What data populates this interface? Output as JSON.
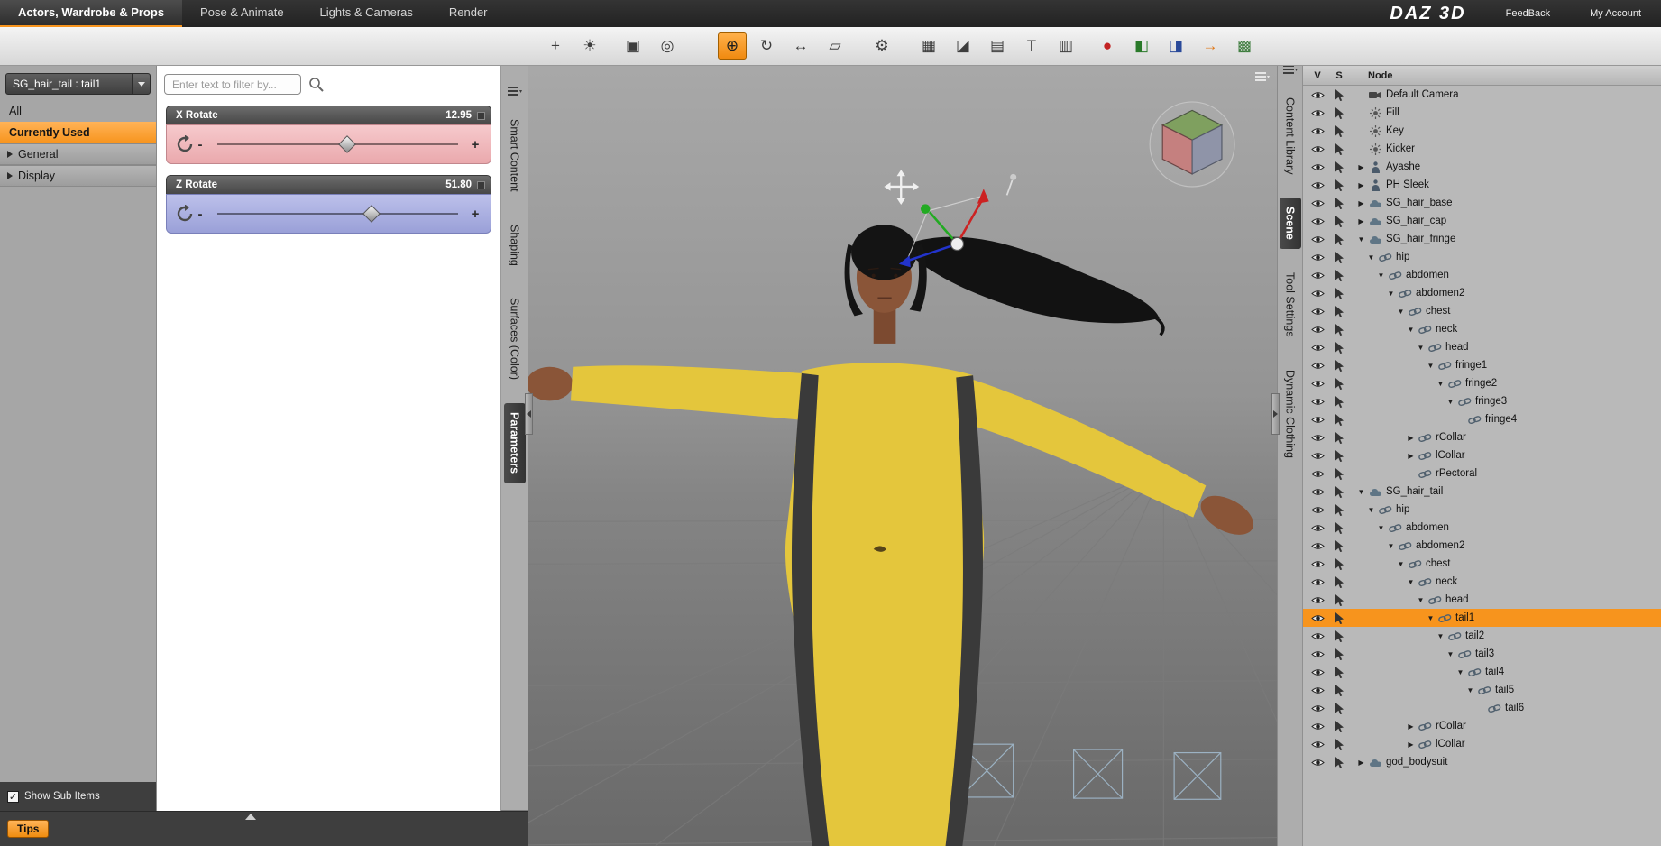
{
  "menubar": {
    "tabs": [
      {
        "label": "Actors, Wardrobe & Props",
        "active": true
      },
      {
        "label": "Pose & Animate",
        "active": false
      },
      {
        "label": "Lights & Cameras",
        "active": false
      },
      {
        "label": "Render",
        "active": false
      }
    ],
    "brand": "DAZ 3D",
    "links": [
      {
        "label": "FeedBack"
      },
      {
        "label": "My Account"
      }
    ]
  },
  "toolbar": {
    "icons": [
      {
        "name": "add-camera-icon",
        "glyph": "+"
      },
      {
        "name": "add-light-icon",
        "glyph": "☀"
      },
      {
        "name": "frame-item-icon",
        "glyph": "▣",
        "gap": 10
      },
      {
        "name": "aim-at-item-icon",
        "glyph": "◎"
      },
      {
        "name": "universal-manipulator-icon",
        "glyph": "⊕",
        "active": true,
        "gap": 34
      },
      {
        "name": "rotate-tool-icon",
        "glyph": "↻"
      },
      {
        "name": "translate-tool-icon",
        "glyph": "↔"
      },
      {
        "name": "scale-tool-icon",
        "glyph": "▱"
      },
      {
        "name": "joint-editor-icon",
        "glyph": "⚙",
        "gap": 14
      },
      {
        "name": "surface-selection-tool-icon",
        "glyph": "▦",
        "gap": 14
      },
      {
        "name": "geometry-editor-icon",
        "glyph": "◪"
      },
      {
        "name": "measure-tool-icon",
        "glyph": "▤"
      },
      {
        "name": "text-annotation-icon",
        "glyph": "T"
      },
      {
        "name": "view-layout-icon",
        "glyph": "▥"
      },
      {
        "name": "render-preview-icon",
        "glyph": "●",
        "color": "#c22222",
        "gap": 8
      },
      {
        "name": "material-preview-icon",
        "glyph": "◧",
        "color": "#2a7a2a"
      },
      {
        "name": "layer-preview-icon",
        "glyph": "◨",
        "color": "#2a4a9a"
      },
      {
        "name": "play-forward-icon",
        "glyph": "→",
        "color": "#e07818"
      },
      {
        "name": "environment-icon",
        "glyph": "▩",
        "color": "#3a7a3a"
      }
    ]
  },
  "left_panel": {
    "node_selector": "SG_hair_tail : tail1",
    "categories": [
      {
        "label": "All",
        "selected": false
      },
      {
        "label": "Currently Used",
        "selected": true
      },
      {
        "label": "General",
        "collapsed": true
      },
      {
        "label": "Display",
        "collapsed": true
      }
    ],
    "show_sub_items_label": "Show Sub Items",
    "show_sub_items_checked": true,
    "tips_label": "Tips"
  },
  "parameters_panel": {
    "filter_placeholder": "Enter text to filter by...",
    "minus_label": "-",
    "plus_label": "+",
    "sliders": [
      {
        "label": "X Rotate",
        "value": "12.95",
        "percent": 54,
        "color": "#eaa9ad",
        "color_light": "#f6c9cc",
        "color_border": "#c2878d"
      },
      {
        "label": "Z Rotate",
        "value": "51.80",
        "percent": 64,
        "color": "#9aa0d8",
        "color_light": "#bcc0ea",
        "color_border": "#7a80ba"
      }
    ]
  },
  "side_tabs_left": [
    {
      "label": "Smart Content",
      "active": false
    },
    {
      "label": "Shaping",
      "active": false
    },
    {
      "label": "Surfaces (Color)",
      "active": false
    },
    {
      "label": "Parameters",
      "active": true
    }
  ],
  "side_tabs_right": [
    {
      "label": "Content Library",
      "active": false
    },
    {
      "label": "Scene",
      "active": true
    },
    {
      "label": "Tool Settings",
      "active": false
    },
    {
      "label": "Dynamic Clothing",
      "active": false
    }
  ],
  "scene_panel": {
    "columns": [
      "V",
      "S",
      "Node"
    ],
    "rows": [
      {
        "label": "Default Camera",
        "indent": 0,
        "exp": "leaf",
        "icon": "camera"
      },
      {
        "label": "Fill",
        "indent": 0,
        "exp": "leaf",
        "icon": "light"
      },
      {
        "label": "Key",
        "indent": 0,
        "exp": "leaf",
        "icon": "light"
      },
      {
        "label": "Kicker",
        "indent": 0,
        "exp": "leaf",
        "icon": "light"
      },
      {
        "label": "Ayashe",
        "indent": 0,
        "exp": "closed",
        "icon": "figure"
      },
      {
        "label": "PH Sleek",
        "indent": 0,
        "exp": "closed",
        "icon": "figure"
      },
      {
        "label": "SG_hair_base",
        "indent": 0,
        "exp": "closed",
        "icon": "prop"
      },
      {
        "label": "SG_hair_cap",
        "indent": 0,
        "exp": "closed",
        "icon": "prop"
      },
      {
        "label": "SG_hair_fringe",
        "indent": 0,
        "exp": "open",
        "icon": "prop"
      },
      {
        "label": "hip",
        "indent": 1,
        "exp": "open",
        "icon": "bone"
      },
      {
        "label": "abdomen",
        "indent": 2,
        "exp": "open",
        "icon": "bone"
      },
      {
        "label": "abdomen2",
        "indent": 3,
        "exp": "open",
        "icon": "bone"
      },
      {
        "label": "chest",
        "indent": 4,
        "exp": "open",
        "icon": "bone"
      },
      {
        "label": "neck",
        "indent": 5,
        "exp": "open",
        "icon": "bone"
      },
      {
        "label": "head",
        "indent": 6,
        "exp": "open",
        "icon": "bone"
      },
      {
        "label": "fringe1",
        "indent": 7,
        "exp": "open",
        "icon": "bone"
      },
      {
        "label": "fringe2",
        "indent": 8,
        "exp": "open",
        "icon": "bone"
      },
      {
        "label": "fringe3",
        "indent": 9,
        "exp": "open",
        "icon": "bone"
      },
      {
        "label": "fringe4",
        "indent": 10,
        "exp": "leaf",
        "icon": "bone"
      },
      {
        "label": "rCollar",
        "indent": 5,
        "exp": "closed",
        "icon": "bone"
      },
      {
        "label": "lCollar",
        "indent": 5,
        "exp": "closed",
        "icon": "bone"
      },
      {
        "label": "rPectoral",
        "indent": 5,
        "exp": "leaf",
        "icon": "bone"
      },
      {
        "label": "SG_hair_tail",
        "indent": 0,
        "exp": "open",
        "icon": "prop"
      },
      {
        "label": "hip",
        "indent": 1,
        "exp": "open",
        "icon": "bone"
      },
      {
        "label": "abdomen",
        "indent": 2,
        "exp": "open",
        "icon": "bone"
      },
      {
        "label": "abdomen2",
        "indent": 3,
        "exp": "open",
        "icon": "bone"
      },
      {
        "label": "chest",
        "indent": 4,
        "exp": "open",
        "icon": "bone"
      },
      {
        "label": "neck",
        "indent": 5,
        "exp": "open",
        "icon": "bone"
      },
      {
        "label": "head",
        "indent": 6,
        "exp": "open",
        "icon": "bone"
      },
      {
        "label": "tail1",
        "indent": 7,
        "exp": "open",
        "icon": "bone",
        "selected": true
      },
      {
        "label": "tail2",
        "indent": 8,
        "exp": "open",
        "icon": "bone"
      },
      {
        "label": "tail3",
        "indent": 9,
        "exp": "open",
        "icon": "bone"
      },
      {
        "label": "tail4",
        "indent": 10,
        "exp": "open",
        "icon": "bone"
      },
      {
        "label": "tail5",
        "indent": 11,
        "exp": "open",
        "icon": "bone"
      },
      {
        "label": "tail6",
        "indent": 12,
        "exp": "leaf",
        "icon": "bone"
      },
      {
        "label": "rCollar",
        "indent": 5,
        "exp": "closed",
        "icon": "bone"
      },
      {
        "label": "lCollar",
        "indent": 5,
        "exp": "closed",
        "icon": "bone"
      },
      {
        "label": "god_bodysuit",
        "indent": 0,
        "exp": "closed",
        "icon": "prop"
      }
    ]
  },
  "colors": {
    "accent": "#f7941d",
    "selection": "#f7941d",
    "slider_x": "#eaa9ad",
    "slider_z": "#9aa0d8"
  }
}
